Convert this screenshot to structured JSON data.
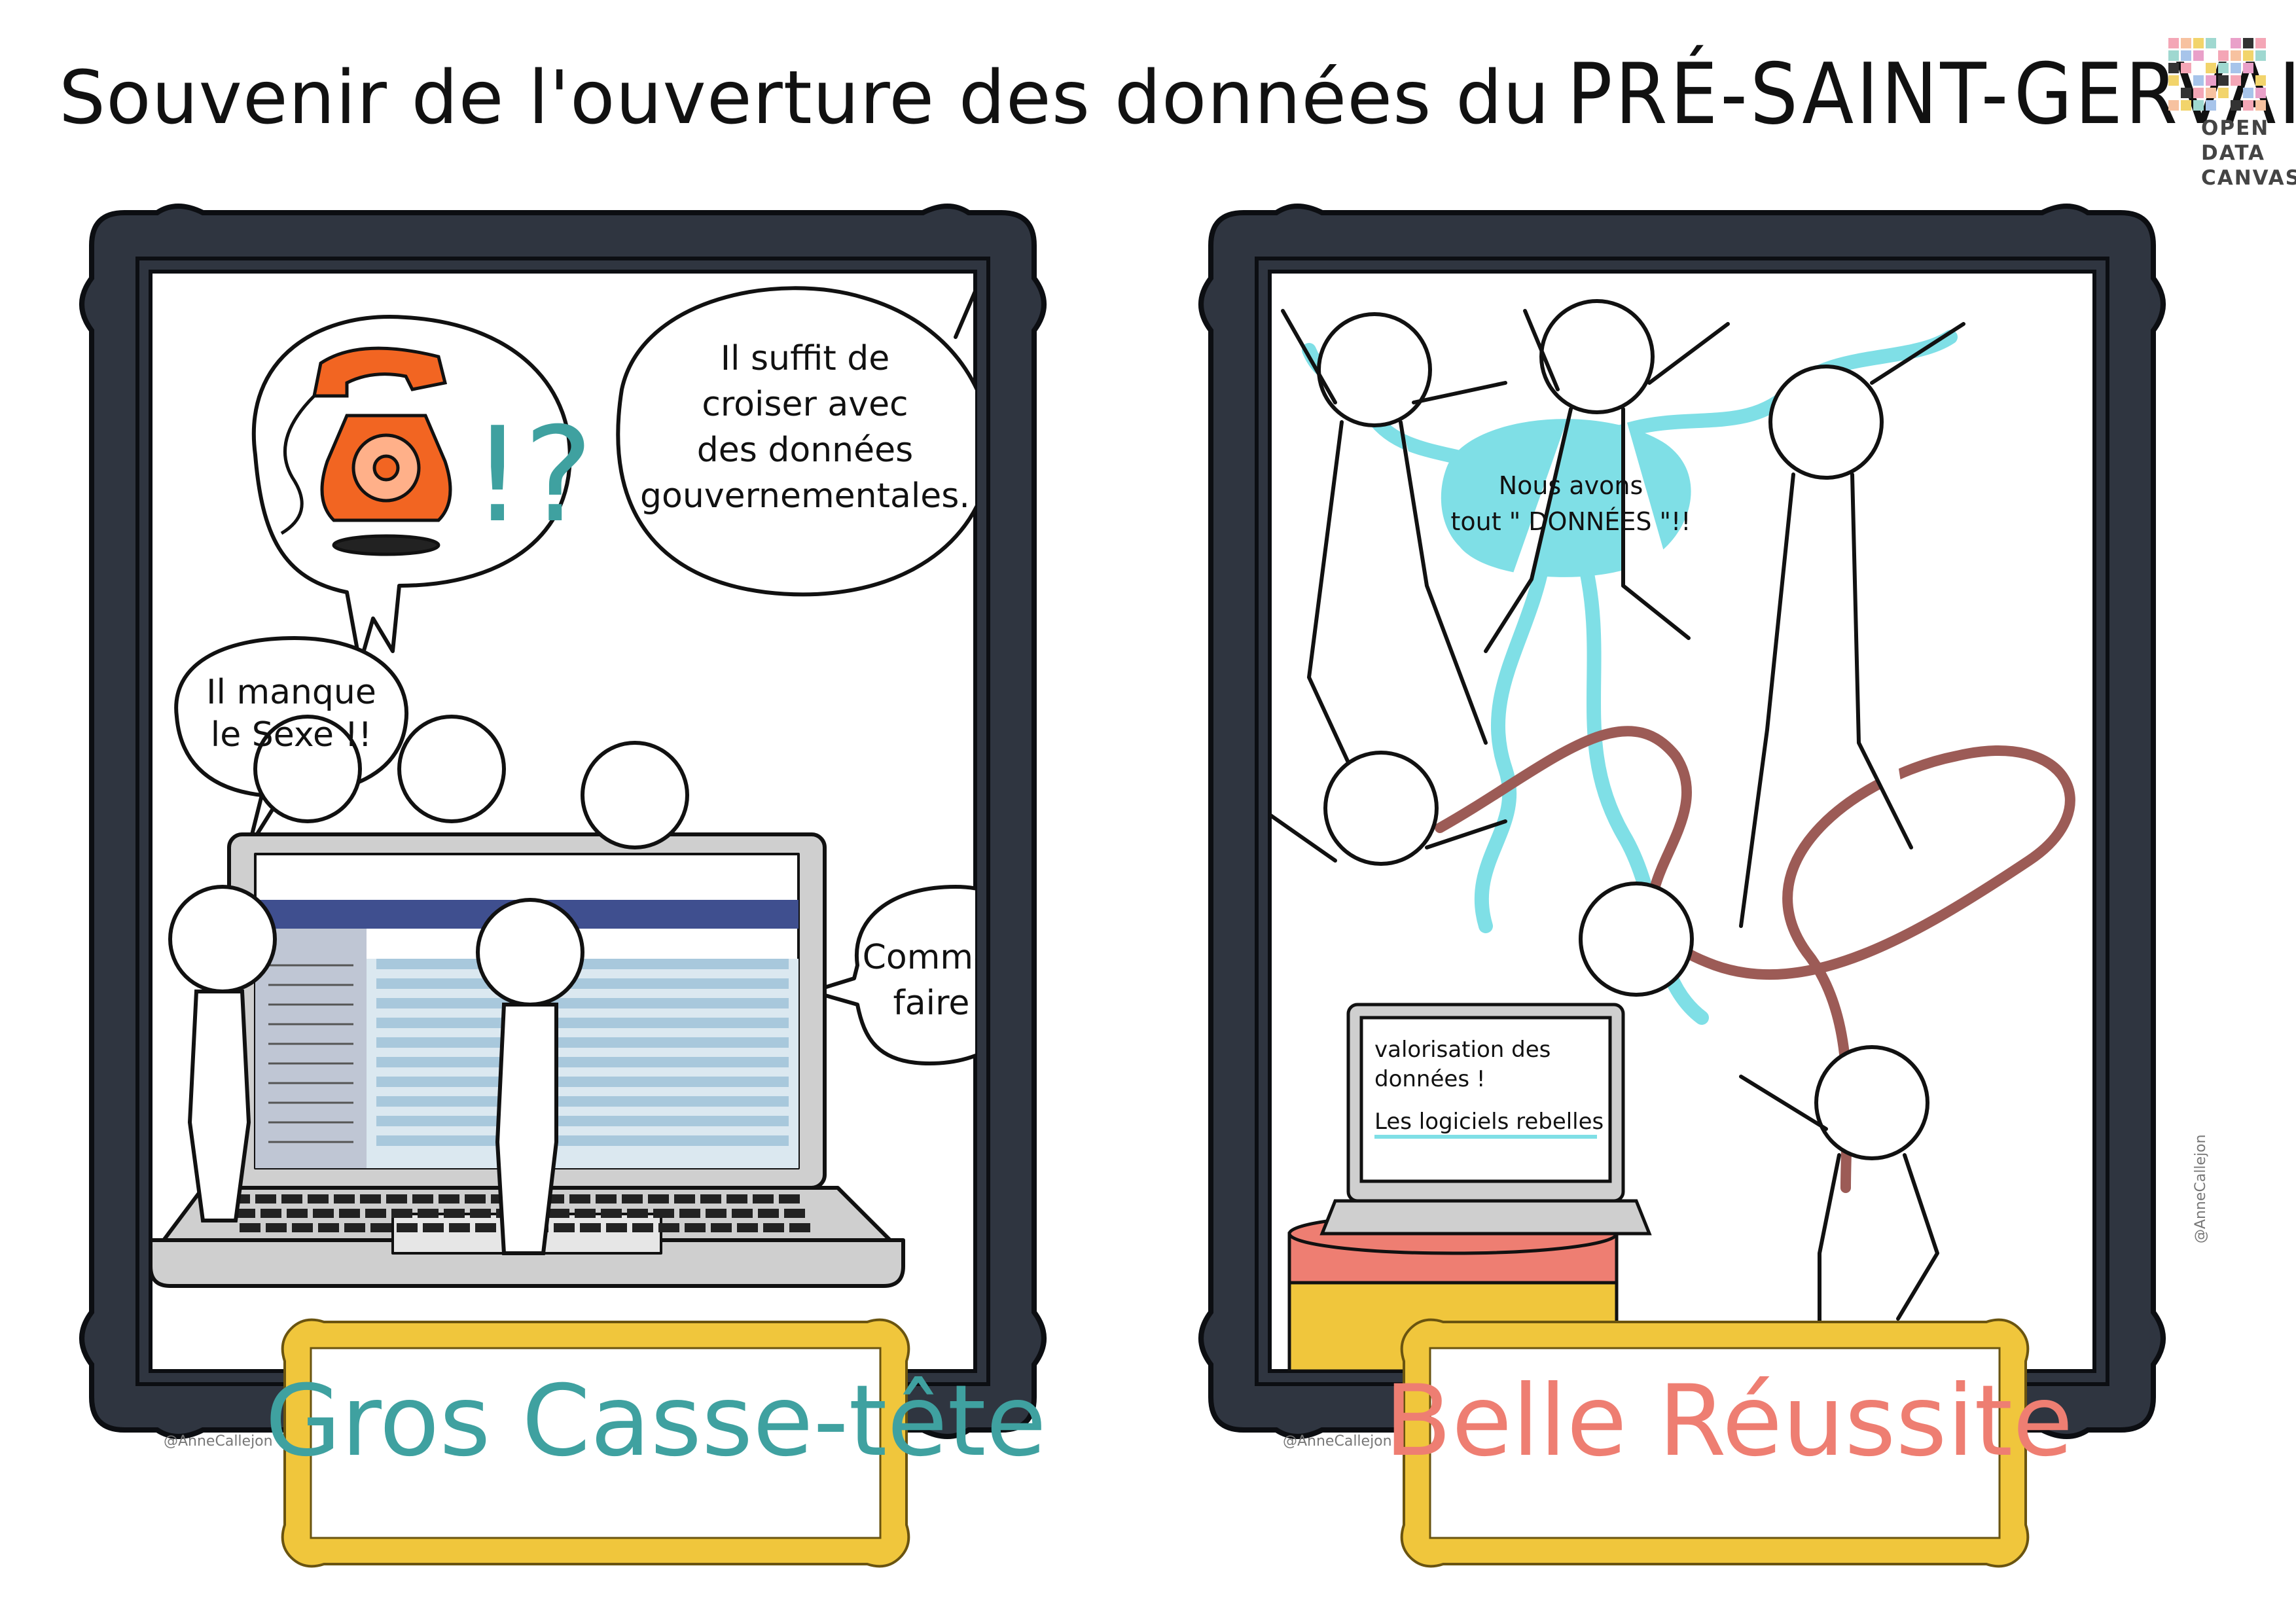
{
  "title": {
    "prefix": "Souvenir de l'ouverture des données du",
    "brand": "PRÉ-SAINT-GERVAIS"
  },
  "logo": {
    "lines": [
      "OPEN",
      "DATA",
      "CANVAS"
    ]
  },
  "left_panel": {
    "bubbles": {
      "phone_symbols": "!?",
      "cross_data": [
        "Il suffit de",
        "croiser avec",
        "des données",
        "gouvernementales."
      ],
      "missing": [
        "Il manque",
        "le Sexe !!"
      ],
      "how": [
        "Comment",
        "faire ?"
      ]
    },
    "plaque": "Gros Casse-tête",
    "signature": "@AnneCallejon"
  },
  "right_panel": {
    "bubble": [
      "Nous avons",
      "tout \" DONNÉES \"!!"
    ],
    "laptop_screen": [
      "valorisation des",
      "données !",
      "Les logiciels rebelles"
    ],
    "plaque": "Belle Réussite",
    "signature": "@AnneCallejon",
    "vertical_signature": "@AnneCallejon"
  },
  "colors": {
    "frame": "#2f3540",
    "frame_outline": "#0c0e12",
    "plaque_gold": "#f0c63c",
    "teal": "#3fa1a0",
    "coral": "#ee7e72",
    "phone_orange": "#f26522",
    "cyan_stream": "#7fdfe6",
    "ribbon": "#9c5b56",
    "screen_blue": "#3f4f8f",
    "row_blue": "#a8c8dc"
  }
}
